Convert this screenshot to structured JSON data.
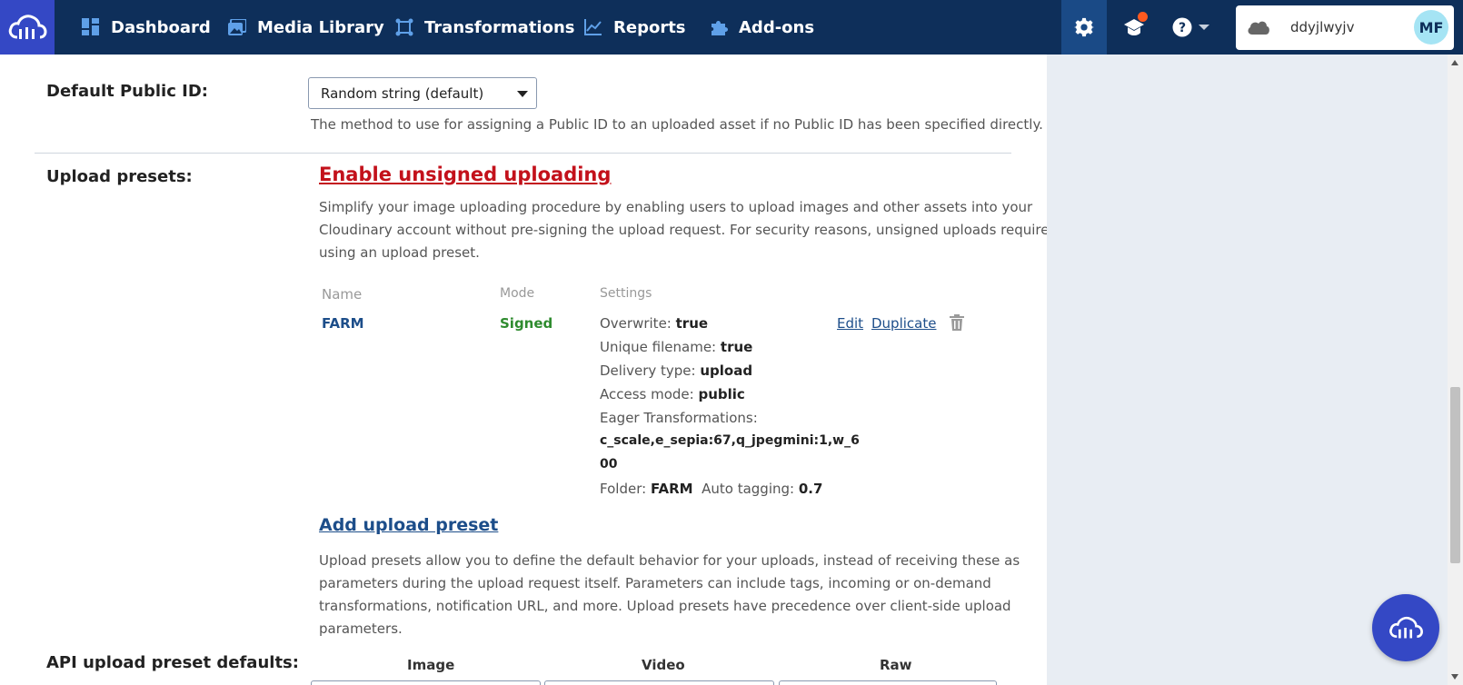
{
  "nav": {
    "items": [
      {
        "label": "Dashboard",
        "icon": "dashboard-icon"
      },
      {
        "label": "Media Library",
        "icon": "media-library-icon"
      },
      {
        "label": "Transformations",
        "icon": "transformations-icon"
      },
      {
        "label": "Reports",
        "icon": "reports-icon"
      },
      {
        "label": "Add-ons",
        "icon": "puzzle-icon"
      }
    ],
    "account_name": "ddyjlwyjv",
    "avatar_initials": "MF",
    "brand_color": "#0e2f5a",
    "accent_color": "#3448c5",
    "notification_color": "#ff5a1f"
  },
  "default_public_id": {
    "label": "Default Public ID:",
    "value": "Random string (default)",
    "help": "The method to use for assigning a Public ID to an uploaded asset if no Public ID has been specified directly."
  },
  "upload_presets": {
    "label": "Upload presets:",
    "enable_link": "Enable unsigned uploading",
    "description_lines": [
      "Simplify your image uploading procedure by enabling users to upload images and other assets into your",
      "Cloudinary account without pre-signing the upload request. For security reasons, unsigned uploads require",
      "using an upload preset."
    ],
    "columns": {
      "name": "Name",
      "mode": "Mode",
      "settings": "Settings"
    },
    "preset": {
      "name": "FARM",
      "mode": "Signed",
      "overwrite_label": "Overwrite:",
      "overwrite_value": "true",
      "unique_label": "Unique filename:",
      "unique_value": "true",
      "delivery_label": "Delivery type:",
      "delivery_value": "upload",
      "access_label": "Access mode:",
      "access_value": "public",
      "eager_label": "Eager Transformations:",
      "eager_line1": "c_scale,e_sepia:67,q_jpegmini:1,w_6",
      "eager_line2": "00",
      "folder_label": "Folder:",
      "folder_value": "FARM",
      "tagging_label": "Auto tagging:",
      "tagging_value": "0.7",
      "edit_label": "Edit",
      "duplicate_label": "Duplicate"
    },
    "add_link": "Add upload preset",
    "add_description_lines": [
      "Upload presets allow you to define the default behavior for your uploads, instead of receiving these as",
      "parameters during the upload request itself. Parameters can include tags, incoming or on-demand",
      "transformations, notification URL, and more. Upload presets have precedence over client-side upload",
      "parameters."
    ]
  },
  "api_defaults": {
    "label": "API upload preset defaults:",
    "columns": [
      "Image",
      "Video",
      "Raw"
    ]
  }
}
